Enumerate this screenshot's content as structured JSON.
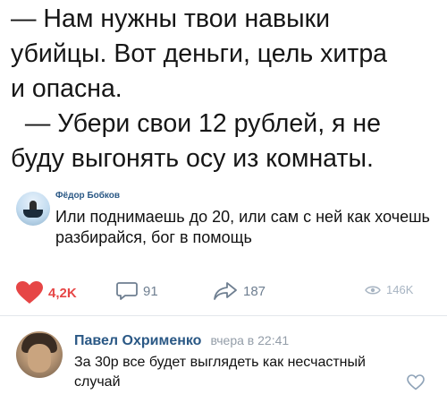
{
  "post": {
    "lines": [
      "— Нам нужны твои навыки",
      "убийцы. Вот деньги, цель хитра",
      "и опасна.",
      "  — Убери свои 12 рублей, я не",
      "буду выгонять осу из комнаты."
    ]
  },
  "comment_top": {
    "author": "Фёдор Бобков",
    "text": "Или поднимаешь до 20, или сам с ней как хочешь разбирайся, бог в помощь"
  },
  "actions": {
    "likes": "4,2K",
    "comments": "91",
    "shares": "187",
    "views": "146K"
  },
  "comment_bottom": {
    "author": "Павел Охрименко",
    "time": "вчера в 22:41",
    "text": "За 30р все будет выглядеть как несчастный случай"
  },
  "colors": {
    "link": "#2a5885",
    "like": "#e64646",
    "muted": "#6f7f91"
  },
  "icons": [
    "heart-icon",
    "comment-icon",
    "share-arrow-icon",
    "eye-icon",
    "heart-outline-icon"
  ]
}
